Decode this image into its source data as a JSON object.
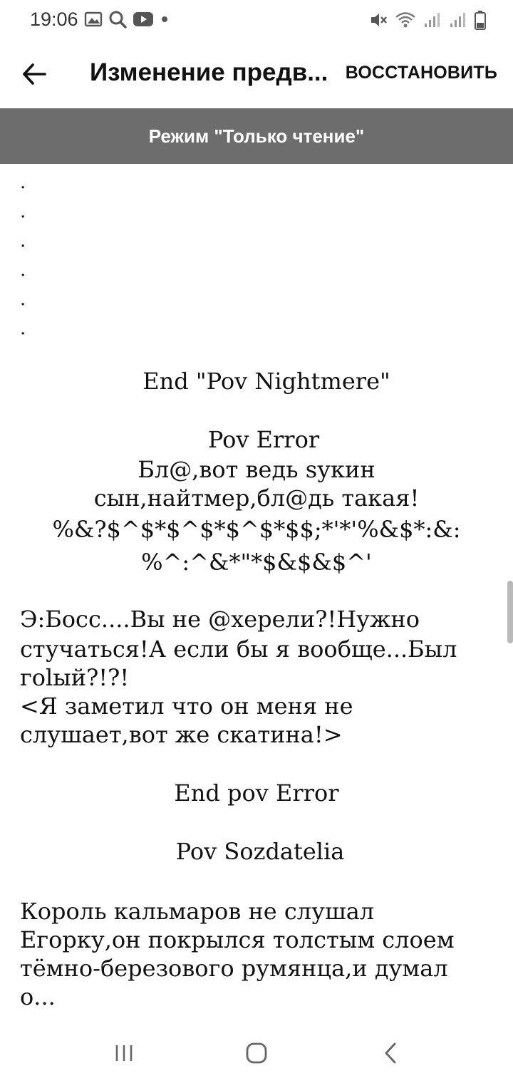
{
  "status_bar": {
    "time": "19:06",
    "left_icons": [
      "image-icon",
      "search-icon",
      "youtube-icon",
      "dot-icon"
    ],
    "right_icons": [
      "mute-icon",
      "wifi-icon",
      "signal-icon",
      "signal-icon-2",
      "battery-icon"
    ]
  },
  "app_bar": {
    "back_icon": "arrow-left-icon",
    "title": "Изменение предв...",
    "restore_label": "ВОССТАНОВИТЬ"
  },
  "banner": {
    "text": "Режим \"Только чтение\""
  },
  "content": {
    "dots": [
      ".",
      ".",
      ".",
      ".",
      ".",
      "."
    ],
    "end_nightmere": "End \"Pov Nightmere\"",
    "pov_error": "Pov Error",
    "error_line1": "Бл@,вот ведь sукин",
    "error_line2": "сын,найтмер,бл@дь такая!",
    "error_line3": "%&?$^$*$^$*$^$*$$;*'*'%&$*:&:",
    "error_line4": "%^:^&*\"*$&$&$^'",
    "p1_line1": "Э:Босс....Вы не @херели?!Нужно",
    "p1_line2": "стучаться!А если бы я вообще...Был",
    "p1_line3": "гоlый?!?!",
    "p1_line4": "<Я заметил что он меня не",
    "p1_line5": "слушает,вот же скатина!>",
    "end_pov_error": "End pov Error",
    "pov_sozdatelia": "Pov Sozdatelia",
    "p2_line1": "Король кальмаров не слушал",
    "p2_line2": "Егорку,он покрылся толстым слоем",
    "p2_line3": "тёмно-березового румянца,и думал",
    "p2_line4": "о..."
  },
  "nav_bar": {
    "recents_icon": "recents-icon",
    "home_icon": "home-icon",
    "back_icon": "back-chevron-icon"
  }
}
